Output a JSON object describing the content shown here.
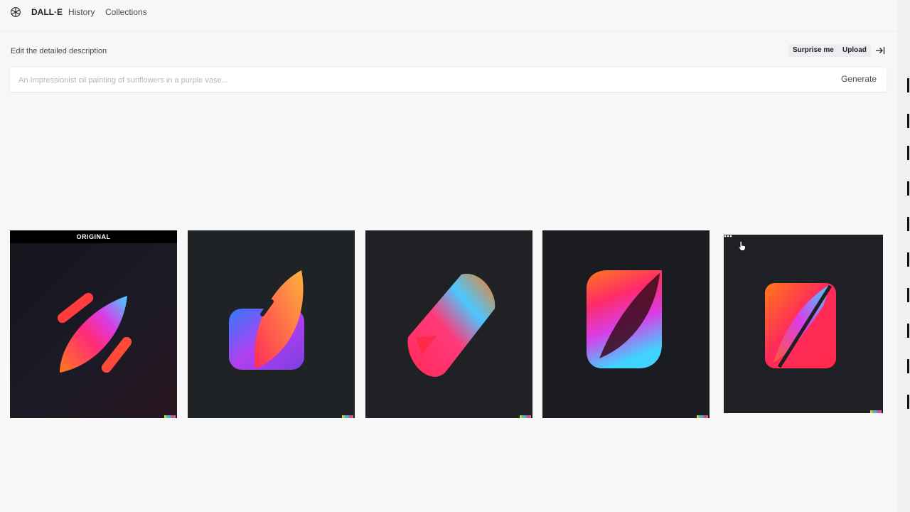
{
  "header": {
    "brand": "DALL·E",
    "nav": [
      "History",
      "Collections"
    ]
  },
  "editor": {
    "label": "Edit the detailed description",
    "surprise_label": "Surprise me",
    "upload_label": "Upload",
    "prompt_placeholder": "An Impressionist oil painting of sunflowers in a purple vase...",
    "prompt_value": "",
    "generate_label": "Generate"
  },
  "gallery": {
    "original_label": "ORIGINAL",
    "tiles": [
      {
        "icon": "rocket-leaf-logo"
      },
      {
        "icon": "leaf-app-logo"
      },
      {
        "icon": "feather-logo"
      },
      {
        "icon": "leaf-square-logo"
      },
      {
        "icon": "slash-square-logo"
      }
    ]
  },
  "colors": {
    "gradient_orange": "#ff7a1a",
    "gradient_pink": "#ff2a7a",
    "gradient_magenta": "#d93de8",
    "gradient_cyan": "#3fd4ff",
    "gradient_purple": "#7a3fe0",
    "tile_dark": "#1d1f23"
  }
}
